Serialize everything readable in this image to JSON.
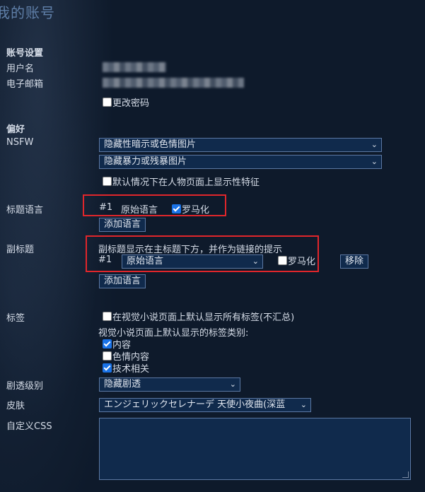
{
  "page_title": "我的账号",
  "account": {
    "section_title": "账号设置",
    "username_label": "用户名",
    "email_label": "电子邮箱",
    "change_password_label": "更改密码"
  },
  "preferences": {
    "section_title": "偏好",
    "nsfw_label": "NSFW",
    "nsfw_select_1": "隐藏性暗示或色情图片",
    "nsfw_select_2": "隐藏暴力或残暴图片",
    "show_sexual_traits_label": "默认情况下在人物页面上显示性特征"
  },
  "title_language": {
    "label": "标题语言",
    "index": "#1",
    "value": "原始语言",
    "romanized_label": "罗马化",
    "romanized_checked": true,
    "add_button": "添加语言"
  },
  "subtitle": {
    "label": "副标题",
    "hint": "副标题显示在主标题下方，并作为链接的提示",
    "index": "#1",
    "select_value": "原始语言",
    "romanized_label": "罗马化",
    "romanized_checked": false,
    "remove_button": "移除",
    "add_button": "添加语言"
  },
  "tags": {
    "label": "标签",
    "show_all_label": "在视觉小说页面上默认显示所有标签(不汇总)",
    "categories_caption": "视觉小说页面上默认显示的标签类别:",
    "categories": [
      {
        "label": "内容",
        "checked": true
      },
      {
        "label": "色情内容",
        "checked": false
      },
      {
        "label": "技术相关",
        "checked": true
      }
    ]
  },
  "spoiler": {
    "label": "剧透级别",
    "value": "隐藏剧透"
  },
  "skin": {
    "label": "皮肤",
    "value": "エンジェリックセレナーデ 天使小夜曲(深蓝"
  },
  "custom_css": {
    "label": "自定义CSS",
    "value": ""
  },
  "colors": {
    "background": "#0e1a2b",
    "control_bg": "#102a4c",
    "control_border": "#5b78a3",
    "highlight_border": "#e0262b",
    "checkbox_checked": "#1a73e8"
  }
}
